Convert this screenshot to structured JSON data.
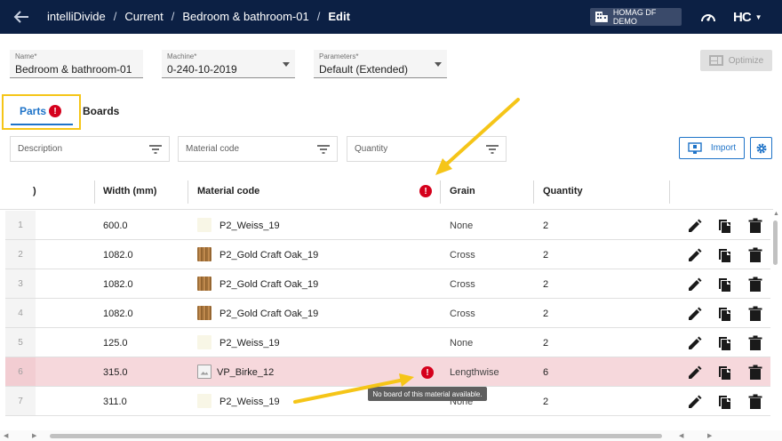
{
  "header": {
    "crumbs": [
      "intelliDivide",
      "Current",
      "Bedroom & bathroom-01",
      "Edit"
    ],
    "company": "HOMAG DF DEMO",
    "logo": "HC"
  },
  "form": {
    "name_label": "Name*",
    "name_value": "Bedroom & bathroom-01",
    "machine_label": "Machine*",
    "machine_value": "0-240-10-2019",
    "params_label": "Parameters*",
    "params_value": "Default (Extended)",
    "optimize_label": "Optimize"
  },
  "tabs": {
    "parts": "Parts",
    "boards": "Boards"
  },
  "filters": {
    "description": "Description",
    "material_code": "Material code",
    "quantity": "Quantity",
    "import": "Import"
  },
  "table": {
    "headers": {
      "col0": ")",
      "width": "Width (mm)",
      "material": "Material code",
      "grain": "Grain",
      "quantity": "Quantity"
    },
    "rows": [
      {
        "num": "1",
        "width": "600.0",
        "material": "P2_Weiss_19",
        "swatch": "weiss",
        "grain": "None",
        "quantity": "2"
      },
      {
        "num": "2",
        "width": "1082.0",
        "material": "P2_Gold Craft Oak_19",
        "swatch": "oak",
        "grain": "Cross",
        "quantity": "2"
      },
      {
        "num": "3",
        "width": "1082.0",
        "material": "P2_Gold Craft Oak_19",
        "swatch": "oak",
        "grain": "Cross",
        "quantity": "2"
      },
      {
        "num": "4",
        "width": "1082.0",
        "material": "P2_Gold Craft Oak_19",
        "swatch": "oak",
        "grain": "Cross",
        "quantity": "2"
      },
      {
        "num": "5",
        "width": "125.0",
        "material": "P2_Weiss_19",
        "swatch": "weiss",
        "grain": "None",
        "quantity": "2"
      },
      {
        "num": "6",
        "width": "315.0",
        "material": "VP_Birke_12",
        "swatch": "image",
        "grain": "Lengthwise",
        "quantity": "6",
        "error": true
      },
      {
        "num": "7",
        "width": "311.0",
        "material": "P2_Weiss_19",
        "swatch": "weiss",
        "grain": "None",
        "quantity": "2"
      }
    ]
  },
  "tooltip": "No board of this material available.",
  "colors": {
    "topbar": "#0c2044",
    "accent": "#1e73c8",
    "error": "#d5001c",
    "error_row": "#f6d8dc",
    "annotation": "#f5c518"
  },
  "icons": {
    "back": "arrow-left-icon",
    "company": "building-icon",
    "gauge": "speedometer-icon",
    "filter": "filter-icon",
    "import": "monitor-import-icon",
    "settings": "gear-icon",
    "edit": "pencil-icon",
    "copy": "copy-icon",
    "delete": "trash-icon",
    "error": "exclamation-circle-icon"
  }
}
